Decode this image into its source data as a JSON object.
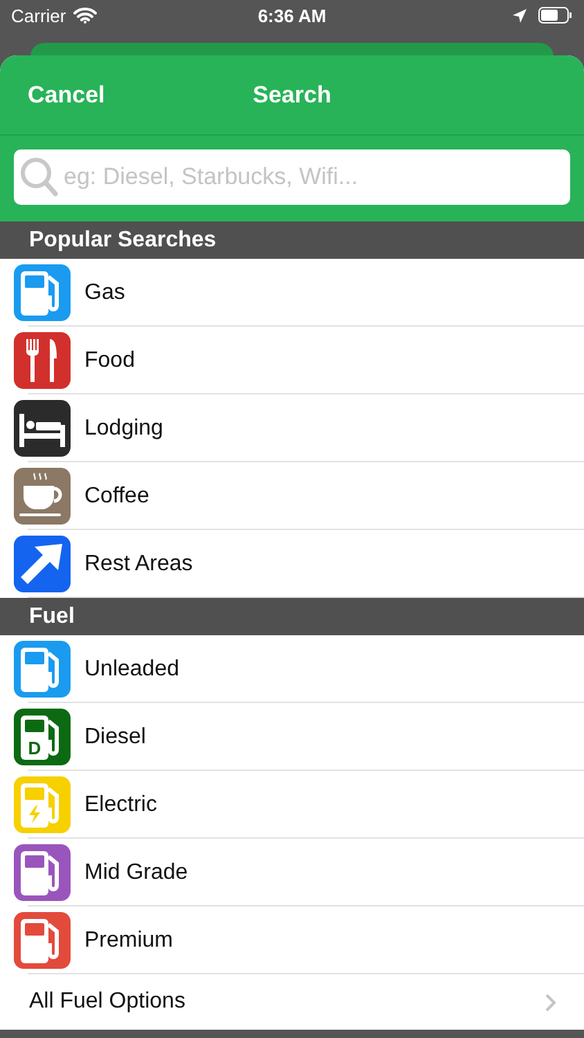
{
  "status_bar": {
    "carrier": "Carrier",
    "time": "6:36 AM"
  },
  "nav": {
    "cancel": "Cancel",
    "title": "Search"
  },
  "search": {
    "placeholder": "eg: Diesel, Starbucks, Wifi..."
  },
  "sections": [
    {
      "title": "Popular Searches",
      "items": [
        {
          "label": "Gas",
          "kind": "pump",
          "color": "#1a9bf0"
        },
        {
          "label": "Food",
          "kind": "food",
          "color": "#d2302c"
        },
        {
          "label": "Lodging",
          "kind": "bed",
          "color": "#2b2b2b"
        },
        {
          "label": "Coffee",
          "kind": "cup",
          "color": "#8b7865"
        },
        {
          "label": "Rest Areas",
          "kind": "arrow",
          "color": "#1464f0"
        }
      ]
    },
    {
      "title": "Fuel",
      "items": [
        {
          "label": "Unleaded",
          "kind": "pump",
          "color": "#1a9bf0"
        },
        {
          "label": "Diesel",
          "kind": "diesel",
          "color": "#0c6a12",
          "icon_letter": "D"
        },
        {
          "label": "Electric",
          "kind": "electric",
          "color": "#f7d000"
        },
        {
          "label": "Mid Grade",
          "kind": "pump",
          "color": "#9a55bc"
        },
        {
          "label": "Premium",
          "kind": "pump",
          "color": "#e24a3c"
        },
        {
          "label": "All Fuel Options",
          "kind": "link"
        }
      ]
    }
  ]
}
